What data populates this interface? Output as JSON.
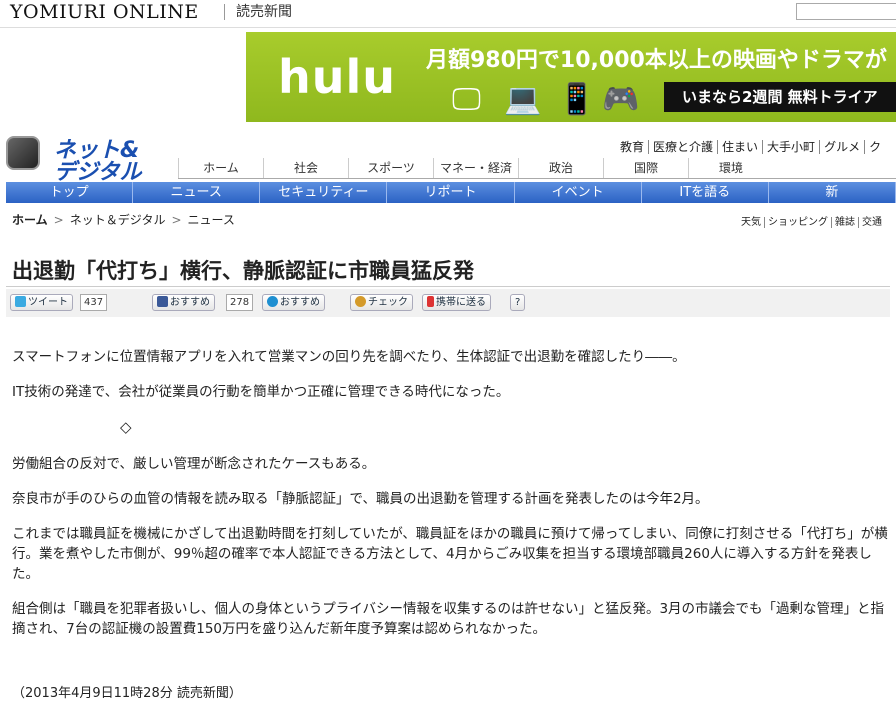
{
  "header": {
    "site_name": "YOMIURI ONLINE",
    "paper_name": "読売新聞"
  },
  "banner": {
    "brand": "hulu",
    "headline": "月額980円で10,000本以上の映画やドラマが",
    "cta": "いまなら2週間 無料トライア",
    "bg_color": "#9ec425"
  },
  "section": {
    "name_line1": "ネット&",
    "name_line2": "デジタル"
  },
  "util_links": [
    "教育",
    "医療と介護",
    "住まい",
    "大手小町",
    "グルメ",
    "ク"
  ],
  "main_nav": [
    "ホーム",
    "社会",
    "スポーツ",
    "マネー・経済",
    "政治",
    "国際",
    "環境"
  ],
  "sub_nav": [
    "トップ",
    "ニュース",
    "セキュリティー",
    "リポート",
    "イベント",
    "ITを語る",
    "新"
  ],
  "breadcrumb": {
    "home": "ホーム",
    "sep": ">",
    "level1": "ネット＆デジタル",
    "level2": "ニュース"
  },
  "right_links": [
    "天気",
    "ショッピング",
    "雑誌",
    "交通"
  ],
  "article": {
    "title": "出退勤「代打ち」横行、静脈認証に市職員猛反発",
    "paragraphs": [
      "スマートフォンに位置情報アプリを入れて営業マンの回り先を調べたり、生体認証で出退勤を確認したり――。",
      "IT技術の発達で、会社が従業員の行動を簡単かつ正確に管理できる時代になった。",
      "◇",
      "労働組合の反対で、厳しい管理が断念されたケースもある。",
      "奈良市が手のひらの血管の情報を読み取る「静脈認証」で、職員の出退勤を管理する計画を発表したのは今年2月。",
      "これまでは職員証を機械にかざして出退勤時間を打刻していたが、職員証をほかの職員に預けて帰ってしまい、同僚に打刻させる「代打ち」が横行。業を煮やした市側が、99％超の確率で本人認証できる方法として、4月からごみ収集を担当する環境部職員260人に導入する方針を発表した。",
      "組合側は「職員を犯罪者扱いし、個人の身体というプライバシー情報を収集するのは許せない」と猛反発。3月の市議会でも「過剰な管理」と指摘され、7台の認証機の設置費150万円を盛り込んだ新年度予算案は認められなかった。"
    ],
    "dateline": "（2013年4月9日11時28分 読売新聞）"
  },
  "social": {
    "tweet_label": "ツイート",
    "tweet_count": "437",
    "fb_label": "おすすめ",
    "fb_count": "278",
    "mixi_label": "おすすめ",
    "check_label": "チェック",
    "mobile_label": "携帯に送る",
    "help_label": "?"
  }
}
